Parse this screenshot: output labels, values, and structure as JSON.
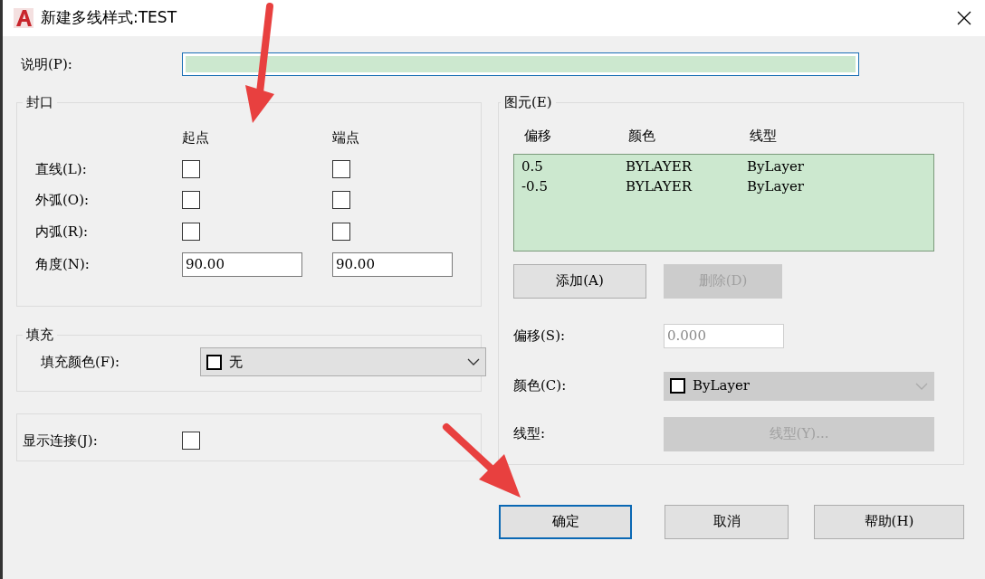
{
  "window": {
    "title": "新建多线样式:TEST"
  },
  "description": {
    "label": "说明(P):",
    "focused": true
  },
  "caps": {
    "title": "封口",
    "columns": [
      "起点",
      "端点"
    ],
    "rows": [
      {
        "label": "直线(L):",
        "start_checked": false,
        "end_checked": false
      },
      {
        "label": "外弧(O):",
        "start_checked": false,
        "end_checked": false
      },
      {
        "label": "内弧(R):",
        "start_checked": false,
        "end_checked": false
      }
    ],
    "angle": {
      "label": "角度(N):",
      "start": "90.00",
      "end": "90.00"
    }
  },
  "fill": {
    "title": "填充",
    "label": "填充颜色(F):",
    "value": "无"
  },
  "show_joints": {
    "label": "显示连接(J):",
    "checked": false
  },
  "elements": {
    "title": "图元(E)",
    "columns": [
      "偏移",
      "颜色",
      "线型"
    ],
    "rows": [
      [
        "0.5",
        "BYLAYER",
        "ByLayer"
      ],
      [
        "-0.5",
        "BYLAYER",
        "ByLayer"
      ]
    ],
    "buttons": [
      {
        "label": "添加(A)",
        "disabled": false
      },
      {
        "label": "删除(D)",
        "disabled": true
      }
    ],
    "offset": {
      "label": "偏移(S):",
      "value": "0.000",
      "disabled": true
    },
    "color": {
      "label": "颜色(C):",
      "value": "ByLayer",
      "disabled": true
    },
    "linetype": {
      "label": "线型:",
      "button": "线型(Y)...",
      "disabled": true
    }
  },
  "buttons": [
    {
      "label": "确定",
      "default": true
    },
    {
      "label": "取消",
      "default": false
    },
    {
      "label": "帮助(H)",
      "default": false
    }
  ]
}
